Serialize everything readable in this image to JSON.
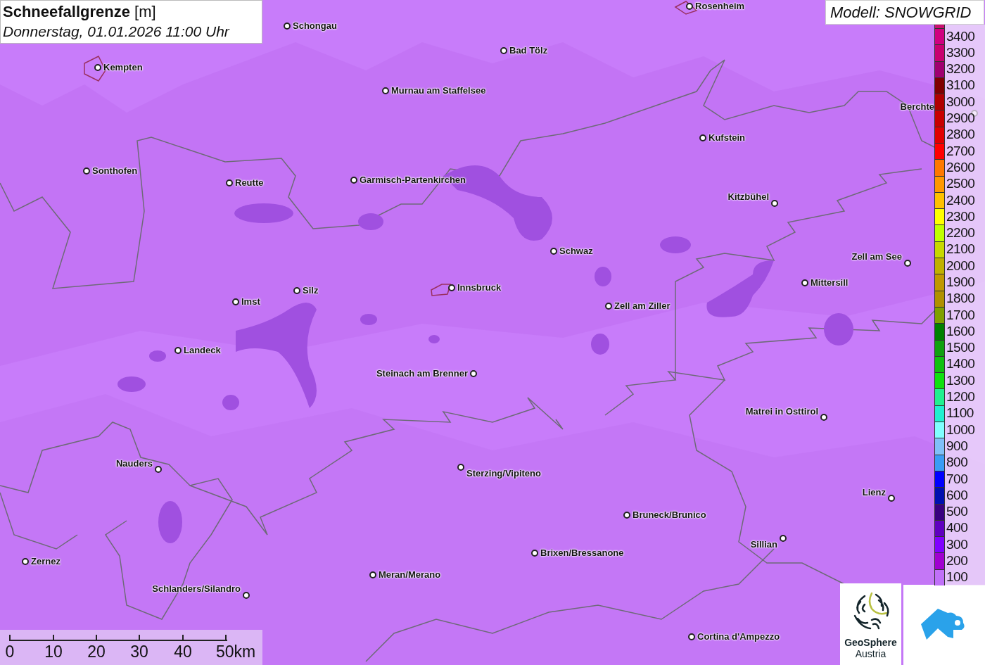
{
  "header": {
    "title": "**Schneefallgrenze** [m]",
    "datetime": "Donnerstag, 01.01.2026 11:00 Uhr"
  },
  "model_label": "Modell: SNOWGRID",
  "cities": [
    {
      "name": "Rosenheim"
    },
    {
      "name": "Schongau"
    },
    {
      "name": "Bad Tölz"
    },
    {
      "name": "Kempten"
    },
    {
      "name": "Murnau am Staffelsee"
    },
    {
      "name": "Berchte"
    },
    {
      "name": "Kufstein"
    },
    {
      "name": "Sonthofen"
    },
    {
      "name": "Reutte"
    },
    {
      "name": "Garmisch-Partenkirchen"
    },
    {
      "name": "Kitzbühel"
    },
    {
      "name": "Schwaz"
    },
    {
      "name": "Zell am See"
    },
    {
      "name": "Mittersill"
    },
    {
      "name": "Silz"
    },
    {
      "name": "Innsbruck"
    },
    {
      "name": "Imst"
    },
    {
      "name": "Zell am Ziller"
    },
    {
      "name": "Landeck"
    },
    {
      "name": "Steinach am Brenner"
    },
    {
      "name": "Matrei in Osttirol"
    },
    {
      "name": "Nauders"
    },
    {
      "name": "Sterzing/Vipiteno"
    },
    {
      "name": "Lienz"
    },
    {
      "name": "Bruneck/Brunico"
    },
    {
      "name": "Sillian"
    },
    {
      "name": "Brixen/Bressanone"
    },
    {
      "name": "Zernez"
    },
    {
      "name": "Meran/Merano"
    },
    {
      "name": "Schlanders/Silandro"
    },
    {
      "name": "Cortina d'Ampezzo"
    }
  ],
  "legend": [
    {
      "color": "#c81070"
    },
    {
      "label": "3400",
      "color": "#d00080"
    },
    {
      "label": "3300",
      "color": "#c80070"
    },
    {
      "label": "3200",
      "color": "#a00070"
    },
    {
      "label": "3100",
      "color": "#800000"
    },
    {
      "label": "3000",
      "color": "#b00000"
    },
    {
      "label": "2900",
      "color": "#c80000"
    },
    {
      "label": "2800",
      "color": "#e00000"
    },
    {
      "label": "2700",
      "color": "#ff0000"
    },
    {
      "label": "2600",
      "color": "#ff7800"
    },
    {
      "label": "2500",
      "color": "#ff9800"
    },
    {
      "label": "2400",
      "color": "#ffc000"
    },
    {
      "label": "2300",
      "color": "#ffff00"
    },
    {
      "label": "2200",
      "color": "#c0ff00"
    },
    {
      "label": "2100",
      "color": "#c8d800"
    },
    {
      "label": "2000",
      "color": "#c0b000"
    },
    {
      "label": "1900",
      "color": "#c09800"
    },
    {
      "label": "1800",
      "color": "#b09000"
    },
    {
      "label": "1700",
      "color": "#80a000"
    },
    {
      "label": "1600",
      "color": "#008000"
    },
    {
      "label": "1500",
      "color": "#10a010"
    },
    {
      "label": "1400",
      "color": "#10c010"
    },
    {
      "label": "1300",
      "color": "#10e010"
    },
    {
      "label": "1200",
      "color": "#20f090"
    },
    {
      "label": "1100",
      "color": "#20f0d0"
    },
    {
      "label": "1000",
      "color": "#80ffff"
    },
    {
      "label": "900",
      "color": "#80c0f8"
    },
    {
      "label": "800",
      "color": "#3a9cf5"
    },
    {
      "label": "700",
      "color": "#0000ff"
    },
    {
      "label": "600",
      "color": "#0010b0"
    },
    {
      "label": "500",
      "color": "#380080"
    },
    {
      "label": "400",
      "color": "#6000c0"
    },
    {
      "label": "300",
      "color": "#8000ff"
    },
    {
      "label": "200",
      "color": "#a000d0"
    },
    {
      "label": "100",
      "color": "#c070f8"
    }
  ],
  "scale_bar": {
    "labels": [
      "0",
      "10",
      "20",
      "30",
      "40",
      "50km"
    ]
  },
  "logo": {
    "line1": "GeoSphere",
    "line2": "Austria"
  }
}
